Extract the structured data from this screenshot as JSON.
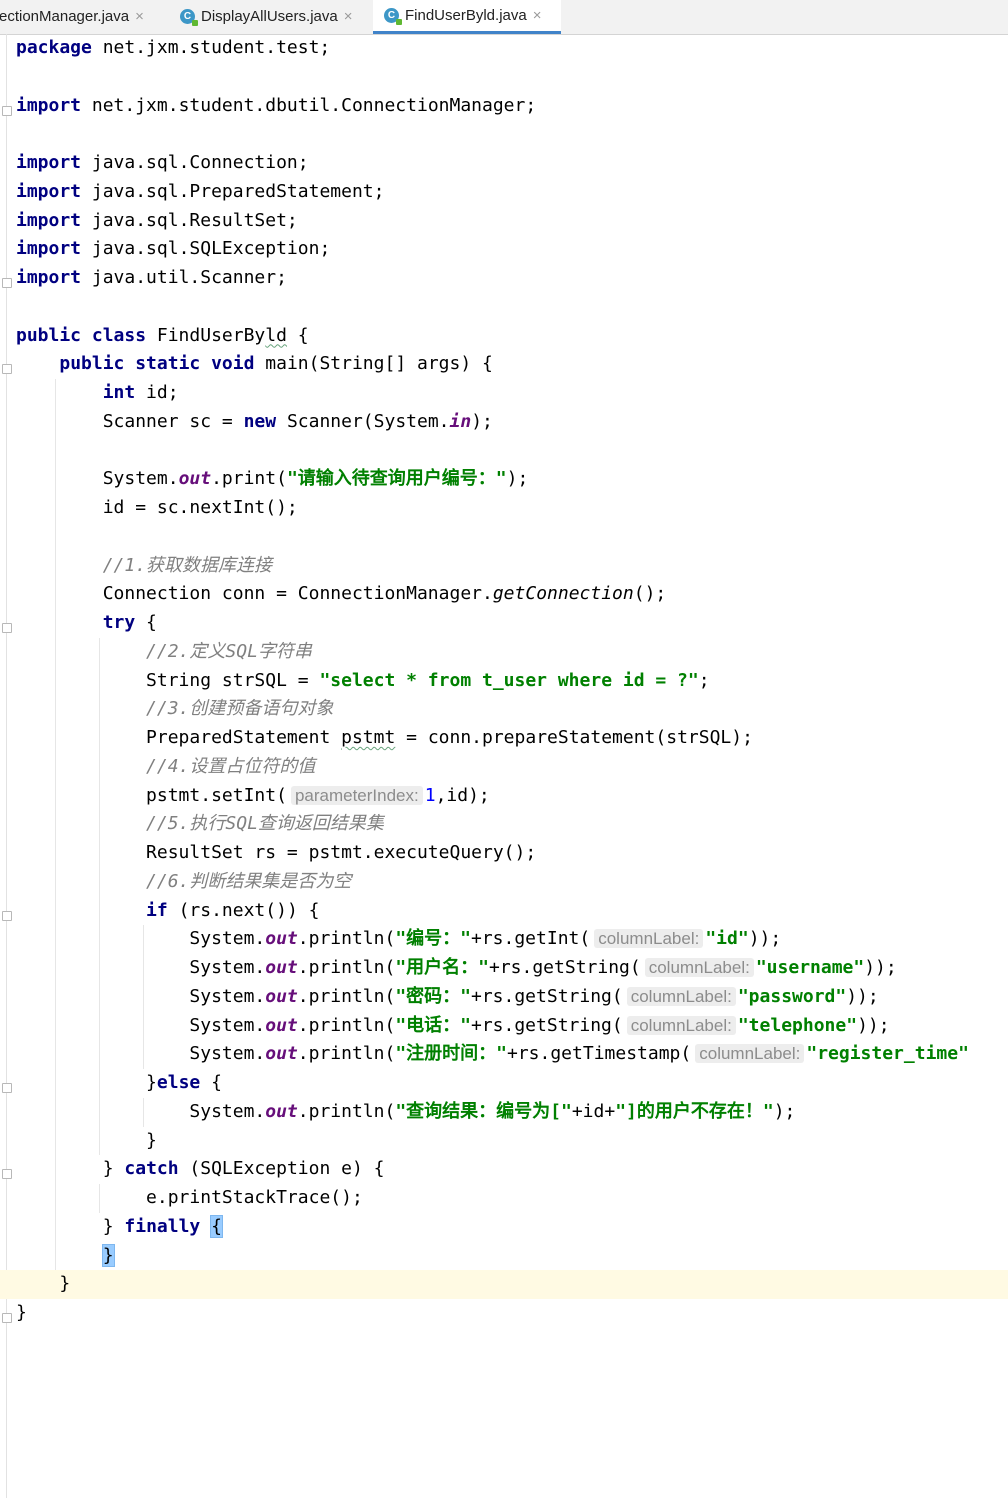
{
  "tabs": [
    {
      "name": "ConnectionManager.java",
      "visible": "ectionManager.java",
      "active": false
    },
    {
      "name": "DisplayAllUsers.java",
      "visible": "DisplayAllUsers.java",
      "active": false
    },
    {
      "name": "FindUserById.java",
      "visible": "FindUserByld.java",
      "active": true
    }
  ],
  "icons": {
    "java_file": "java-class-icon",
    "close": "close-icon"
  },
  "colors": {
    "keyword": "#000080",
    "string": "#008000",
    "comment": "#808080",
    "static_field": "#660e7a",
    "number": "#0000ff",
    "caret_line": "#fffae3",
    "brace_match": "#99ccff",
    "tab_underline": "#4083c9"
  },
  "editor": {
    "current_line": 43,
    "lines": [
      {
        "indent": 0,
        "tokens": [
          {
            "t": "kw",
            "v": "package"
          },
          {
            "t": "p",
            "v": " net.jxm.student.test;"
          }
        ]
      },
      {
        "indent": 0,
        "tokens": []
      },
      {
        "indent": 0,
        "tokens": [
          {
            "t": "kw",
            "v": "import"
          },
          {
            "t": "p",
            "v": " net.jxm.student.dbutil.ConnectionManager;"
          }
        ]
      },
      {
        "indent": 0,
        "tokens": []
      },
      {
        "indent": 0,
        "tokens": [
          {
            "t": "kw",
            "v": "import"
          },
          {
            "t": "p",
            "v": " java.sql.Connection;"
          }
        ]
      },
      {
        "indent": 0,
        "tokens": [
          {
            "t": "kw",
            "v": "import"
          },
          {
            "t": "p",
            "v": " java.sql.PreparedStatement;"
          }
        ]
      },
      {
        "indent": 0,
        "tokens": [
          {
            "t": "kw",
            "v": "import"
          },
          {
            "t": "p",
            "v": " java.sql.ResultSet;"
          }
        ]
      },
      {
        "indent": 0,
        "tokens": [
          {
            "t": "kw",
            "v": "import"
          },
          {
            "t": "p",
            "v": " java.sql.SQLException;"
          }
        ]
      },
      {
        "indent": 0,
        "tokens": [
          {
            "t": "kw",
            "v": "import"
          },
          {
            "t": "p",
            "v": " java.util.Scanner;"
          }
        ]
      },
      {
        "indent": 0,
        "tokens": []
      },
      {
        "indent": 0,
        "tokens": [
          {
            "t": "kw",
            "v": "public class"
          },
          {
            "t": "p",
            "v": " FindUserBy"
          },
          {
            "t": "w",
            "v": "ld"
          },
          {
            "t": "p",
            "v": " {"
          }
        ]
      },
      {
        "indent": 1,
        "tokens": [
          {
            "t": "kw",
            "v": "public static void"
          },
          {
            "t": "p",
            "v": " main(String[] args) {"
          }
        ]
      },
      {
        "indent": 2,
        "tokens": [
          {
            "t": "kw",
            "v": "int"
          },
          {
            "t": "p",
            "v": " id;"
          }
        ]
      },
      {
        "indent": 2,
        "tokens": [
          {
            "t": "p",
            "v": "Scanner sc = "
          },
          {
            "t": "kw",
            "v": "new"
          },
          {
            "t": "p",
            "v": " Scanner(System."
          },
          {
            "t": "f",
            "v": "in"
          },
          {
            "t": "p",
            "v": ");"
          }
        ]
      },
      {
        "indent": 2,
        "tokens": []
      },
      {
        "indent": 2,
        "tokens": [
          {
            "t": "p",
            "v": "System."
          },
          {
            "t": "f",
            "v": "out"
          },
          {
            "t": "p",
            "v": ".print("
          },
          {
            "t": "s",
            "v": "\"请输入待查询用户编号：\""
          },
          {
            "t": "p",
            "v": ");"
          }
        ]
      },
      {
        "indent": 2,
        "tokens": [
          {
            "t": "p",
            "v": "id = sc.nextInt();"
          }
        ]
      },
      {
        "indent": 2,
        "tokens": []
      },
      {
        "indent": 2,
        "tokens": [
          {
            "t": "c",
            "v": "//1.获取数据库连接"
          }
        ]
      },
      {
        "indent": 2,
        "tokens": [
          {
            "t": "p",
            "v": "Connection conn = ConnectionManager."
          },
          {
            "t": "i",
            "v": "getConnection"
          },
          {
            "t": "p",
            "v": "();"
          }
        ]
      },
      {
        "indent": 2,
        "tokens": [
          {
            "t": "kw",
            "v": "try"
          },
          {
            "t": "p",
            "v": " {"
          }
        ]
      },
      {
        "indent": 3,
        "tokens": [
          {
            "t": "c",
            "v": "//2.定义SQL字符串"
          }
        ]
      },
      {
        "indent": 3,
        "tokens": [
          {
            "t": "p",
            "v": "String strSQL = "
          },
          {
            "t": "s",
            "v": "\"select * from t_user where id = ?\""
          },
          {
            "t": "p",
            "v": ";"
          }
        ]
      },
      {
        "indent": 3,
        "tokens": [
          {
            "t": "c",
            "v": "//3.创建预备语句对象"
          }
        ]
      },
      {
        "indent": 3,
        "tokens": [
          {
            "t": "p",
            "v": "PreparedStatement "
          },
          {
            "t": "w",
            "v": "pstmt"
          },
          {
            "t": "p",
            "v": " = conn.prepareStatement(strSQL);"
          }
        ]
      },
      {
        "indent": 3,
        "tokens": [
          {
            "t": "c",
            "v": "//4.设置占位符的值"
          }
        ]
      },
      {
        "indent": 3,
        "tokens": [
          {
            "t": "p",
            "v": "pstmt.setInt("
          },
          {
            "t": "h",
            "v": "parameterIndex:"
          },
          {
            "t": "n",
            "v": "1"
          },
          {
            "t": "p",
            "v": ",id);"
          }
        ]
      },
      {
        "indent": 3,
        "tokens": [
          {
            "t": "c",
            "v": "//5.执行SQL查询返回结果集"
          }
        ]
      },
      {
        "indent": 3,
        "tokens": [
          {
            "t": "p",
            "v": "ResultSet rs = pstmt.executeQuery();"
          }
        ]
      },
      {
        "indent": 3,
        "tokens": [
          {
            "t": "c",
            "v": "//6.判断结果集是否为空"
          }
        ]
      },
      {
        "indent": 3,
        "tokens": [
          {
            "t": "kw",
            "v": "if"
          },
          {
            "t": "p",
            "v": " (rs.next()) {"
          }
        ]
      },
      {
        "indent": 4,
        "tokens": [
          {
            "t": "p",
            "v": "System."
          },
          {
            "t": "f",
            "v": "out"
          },
          {
            "t": "p",
            "v": ".println("
          },
          {
            "t": "s",
            "v": "\"编号：\""
          },
          {
            "t": "p",
            "v": "+rs.getInt("
          },
          {
            "t": "h",
            "v": "columnLabel:"
          },
          {
            "t": "s",
            "v": "\"id\""
          },
          {
            "t": "p",
            "v": "));"
          }
        ]
      },
      {
        "indent": 4,
        "tokens": [
          {
            "t": "p",
            "v": "System."
          },
          {
            "t": "f",
            "v": "out"
          },
          {
            "t": "p",
            "v": ".println("
          },
          {
            "t": "s",
            "v": "\"用户名：\""
          },
          {
            "t": "p",
            "v": "+rs.getString("
          },
          {
            "t": "h",
            "v": "columnLabel:"
          },
          {
            "t": "s",
            "v": "\"username\""
          },
          {
            "t": "p",
            "v": "));"
          }
        ]
      },
      {
        "indent": 4,
        "tokens": [
          {
            "t": "p",
            "v": "System."
          },
          {
            "t": "f",
            "v": "out"
          },
          {
            "t": "p",
            "v": ".println("
          },
          {
            "t": "s",
            "v": "\"密码：\""
          },
          {
            "t": "p",
            "v": "+rs.getString("
          },
          {
            "t": "h",
            "v": "columnLabel:"
          },
          {
            "t": "s",
            "v": "\"password\""
          },
          {
            "t": "p",
            "v": "));"
          }
        ]
      },
      {
        "indent": 4,
        "tokens": [
          {
            "t": "p",
            "v": "System."
          },
          {
            "t": "f",
            "v": "out"
          },
          {
            "t": "p",
            "v": ".println("
          },
          {
            "t": "s",
            "v": "\"电话：\""
          },
          {
            "t": "p",
            "v": "+rs.getString("
          },
          {
            "t": "h",
            "v": "columnLabel:"
          },
          {
            "t": "s",
            "v": "\"telephone\""
          },
          {
            "t": "p",
            "v": "));"
          }
        ]
      },
      {
        "indent": 4,
        "tokens": [
          {
            "t": "p",
            "v": "System."
          },
          {
            "t": "f",
            "v": "out"
          },
          {
            "t": "p",
            "v": ".println("
          },
          {
            "t": "s",
            "v": "\"注册时间：\""
          },
          {
            "t": "p",
            "v": "+rs.getTimestamp("
          },
          {
            "t": "h",
            "v": "columnLabel:"
          },
          {
            "t": "s",
            "v": "\"register_time\""
          }
        ]
      },
      {
        "indent": 3,
        "tokens": [
          {
            "t": "p",
            "v": "}"
          },
          {
            "t": "kw",
            "v": "else"
          },
          {
            "t": "p",
            "v": " {"
          }
        ]
      },
      {
        "indent": 4,
        "tokens": [
          {
            "t": "p",
            "v": "System."
          },
          {
            "t": "f",
            "v": "out"
          },
          {
            "t": "p",
            "v": ".println("
          },
          {
            "t": "s",
            "v": "\"查询结果：编号为[\""
          },
          {
            "t": "p",
            "v": "+id+"
          },
          {
            "t": "s",
            "v": "\"]的用户不存在！\""
          },
          {
            "t": "p",
            "v": ");"
          }
        ]
      },
      {
        "indent": 3,
        "tokens": [
          {
            "t": "p",
            "v": "}"
          }
        ]
      },
      {
        "indent": 2,
        "tokens": [
          {
            "t": "p",
            "v": "} "
          },
          {
            "t": "kw",
            "v": "catch"
          },
          {
            "t": "p",
            "v": " (SQLException e) {"
          }
        ]
      },
      {
        "indent": 3,
        "tokens": [
          {
            "t": "p",
            "v": "e.printStackTrace();"
          }
        ]
      },
      {
        "indent": 2,
        "tokens": [
          {
            "t": "p",
            "v": "} "
          },
          {
            "t": "kw",
            "v": "finally"
          },
          {
            "t": "p",
            "v": " "
          },
          {
            "t": "b",
            "v": "{"
          }
        ]
      },
      {
        "indent": 2,
        "tokens": [
          {
            "t": "b",
            "v": "}"
          }
        ]
      },
      {
        "indent": 1,
        "tokens": [
          {
            "t": "p",
            "v": "}"
          }
        ]
      },
      {
        "indent": 0,
        "tokens": [
          {
            "t": "p",
            "v": "}"
          }
        ]
      }
    ]
  }
}
